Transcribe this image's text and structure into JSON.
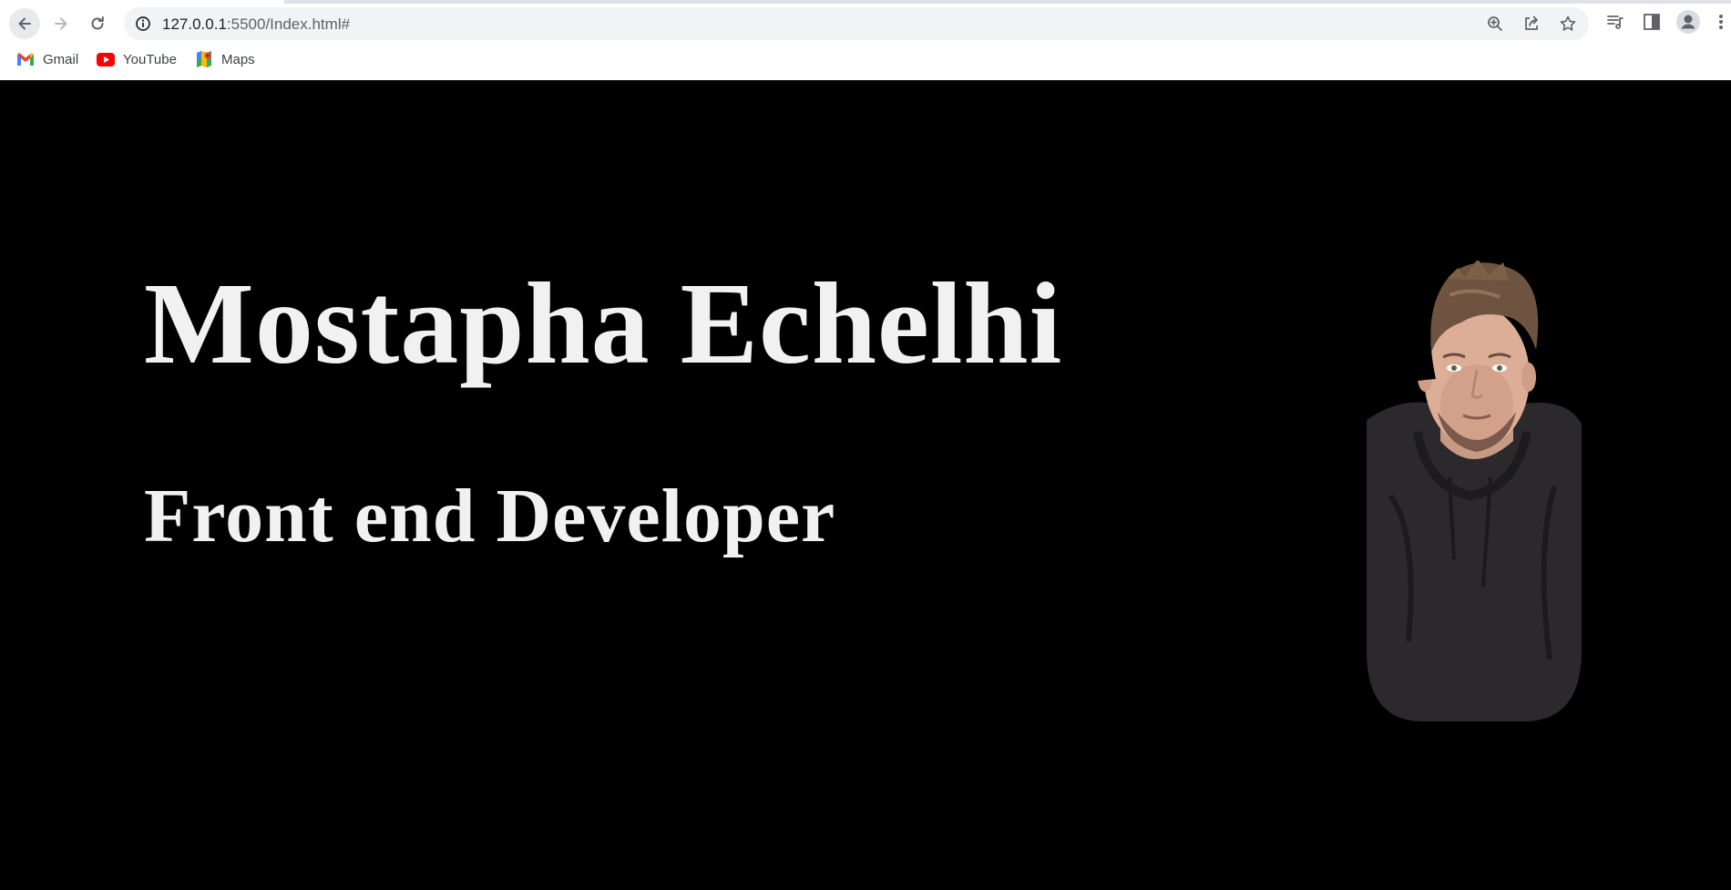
{
  "browser": {
    "url_host": "127.0.0.1",
    "url_path": ":5500/Index.html#",
    "icons": {
      "back": "arrow-left-icon",
      "forward": "arrow-right-icon",
      "reload": "reload-icon",
      "site_info": "info-icon",
      "zoom": "zoom-icon",
      "share": "share-icon",
      "bookmark": "star-icon",
      "reading_list": "reading-list-icon",
      "side_panel": "side-panel-icon",
      "profile": "profile-icon",
      "menu": "kebab-menu-icon"
    }
  },
  "bookmarks": [
    {
      "label": "Gmail",
      "icon": "gmail-icon"
    },
    {
      "label": "YouTube",
      "icon": "youtube-icon"
    },
    {
      "label": "Maps",
      "icon": "maps-icon"
    }
  ],
  "hero": {
    "name": "Mostapha Echelhi",
    "role": "Front end Developer"
  },
  "colors": {
    "page_background": "#000000",
    "hero_text": "#f1f1f1",
    "omnibox": "#f1f3f4"
  }
}
